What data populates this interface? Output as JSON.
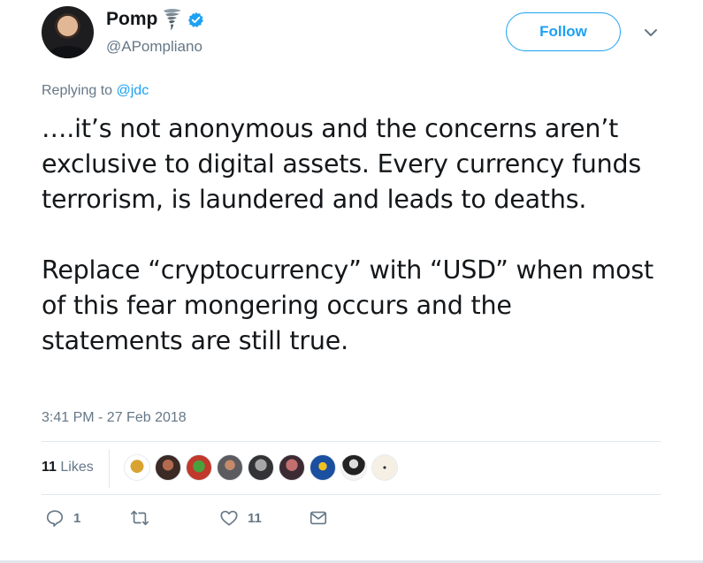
{
  "author": {
    "name": "Pomp",
    "handle": "@APompliano",
    "name_emoji": "tornado-icon",
    "verified_icon": "verified-badge-icon"
  },
  "follow_button_label": "Follow",
  "more_icon": "chevron-down-icon",
  "reply": {
    "prefix": "Replying to ",
    "target": "@jdc"
  },
  "tweet": {
    "paragraphs": [
      "….it’s not anonymous and the concerns aren’t exclusive to digital assets. Every currency funds terrorism, is laundered and leads to deaths.",
      "Replace “cryptocurrency” with “USD” when most of this fear mongering occurs and the statements are still true."
    ]
  },
  "timestamp": "3:41 PM - 27 Feb 2018",
  "likes": {
    "count": "11",
    "label": "Likes"
  },
  "actions": {
    "reply_count": "1",
    "retweet_count": "",
    "like_count": "11"
  },
  "colors": {
    "accent": "#1da1f2",
    "secondary_text": "#657786",
    "divider": "#e1e8ed"
  }
}
